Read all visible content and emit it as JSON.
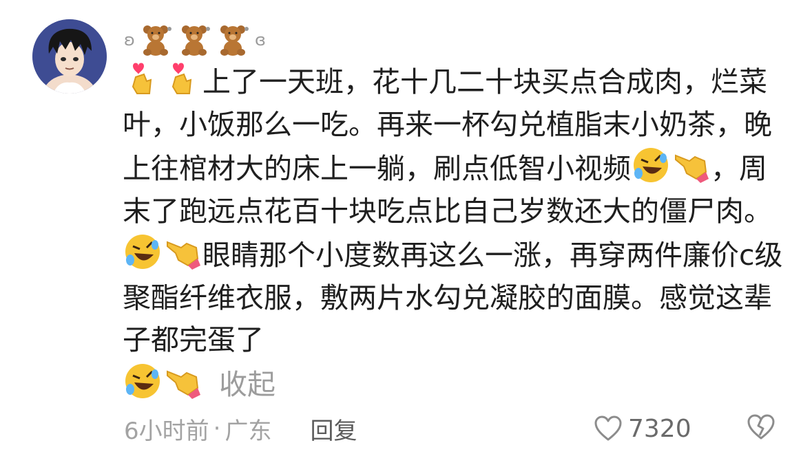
{
  "comment": {
    "username_swirl_left": "ʚ",
    "username_swirl_right": "ɞ",
    "username_icons": [
      "bear-icon",
      "bear-icon",
      "bear-icon"
    ],
    "text_segments": [
      "上了一天班，花十几二十块买点合成肉，烂菜叶，小饭那么一吃。再来一杯勾兑植脂末小奶茶，晚上往棺材大的床上一躺，刷点低智小视频",
      "，周末了跑远点花百十块吃点比自己岁数还大的僵尸肉。",
      "眼睛那个小度数再这么一涨，再穿两件廉价c级聚酯纤维衣服，敷两片水勾兑凝胶的面膜。感觉这辈子都完蛋了"
    ],
    "emojis": [
      "heart-hands-icon",
      "rolling-laughing-icon",
      "pointing-hand-icon"
    ],
    "collapse_label": "收起",
    "time": "6小时前",
    "separator": "·",
    "location": "广东",
    "reply_label": "回复",
    "like_count": "7320"
  },
  "colors": {
    "text": "#1f1f1f",
    "muted": "#a3a3a3",
    "reply": "#5c5c5c",
    "emoji_yellow": "#f7c432"
  }
}
